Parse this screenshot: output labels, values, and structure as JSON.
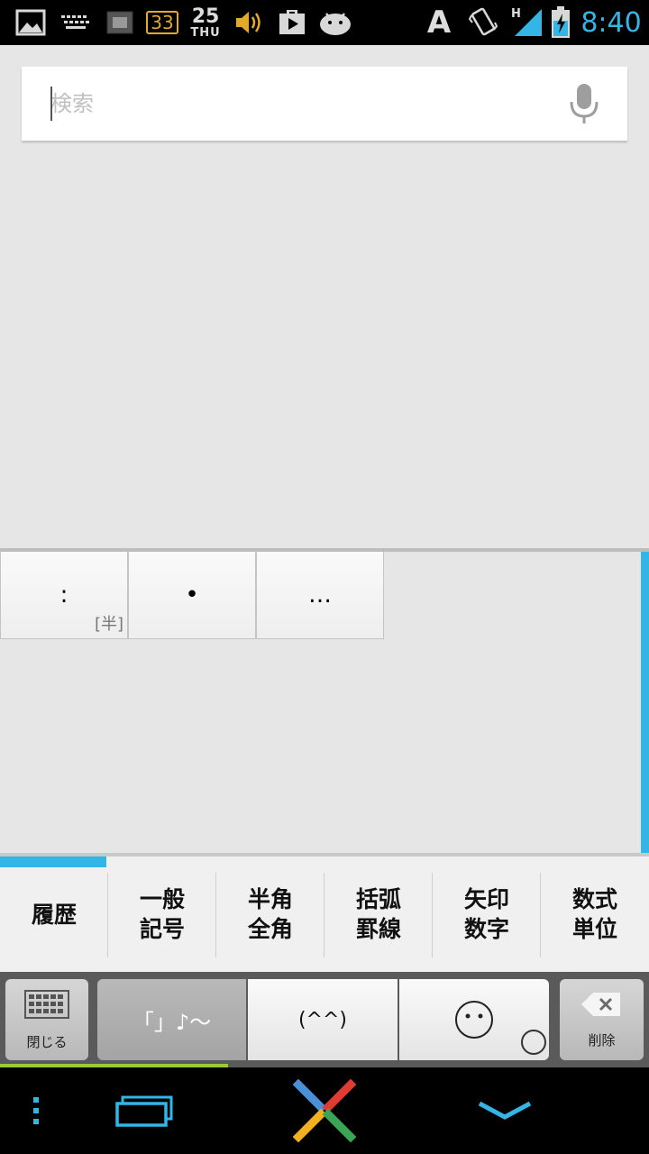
{
  "status_bar": {
    "icons": [
      "gallery-icon",
      "keyboard-icon",
      "screen-icon",
      "temperature-badge-icon",
      "calendar-icon",
      "volume-icon",
      "play-store-icon",
      "android-icon",
      "font-a-icon",
      "vibrate-icon",
      "signal-icon",
      "battery-charging-icon"
    ],
    "temperature": "33",
    "date_day": "25",
    "date_weekday": "THU",
    "font_letter": "A",
    "network_type": "H",
    "time": "8:40"
  },
  "search": {
    "placeholder": "検索",
    "mic_icon": "microphone-icon"
  },
  "candidates": [
    {
      "symbol": ":",
      "tag": "[半]"
    },
    {
      "symbol": "•",
      "tag": ""
    },
    {
      "symbol": "…",
      "tag": ""
    }
  ],
  "tabs": [
    {
      "line1": "履歴",
      "line2": "",
      "active": true
    },
    {
      "line1": "一般",
      "line2": "記号",
      "active": false
    },
    {
      "line1": "半角",
      "line2": "全角",
      "active": false
    },
    {
      "line1": "括弧",
      "line2": "罫線",
      "active": false
    },
    {
      "line1": "矢印",
      "line2": "数字",
      "active": false
    },
    {
      "line1": "数式",
      "line2": "単位",
      "active": false
    }
  ],
  "keys": {
    "close_label": "閉じる",
    "mode_symbols": "「」♪～",
    "mode_emoticon": "(^^)",
    "mode_emoji": "emoji-face-icon",
    "delete_label": "削除"
  },
  "colors": {
    "accent": "#33b5e5",
    "progress": "#99cc33"
  },
  "nav": {
    "icons": [
      "menu-dots-icon",
      "recent-apps-icon",
      "home-x-icon",
      "hide-keyboard-icon"
    ]
  }
}
